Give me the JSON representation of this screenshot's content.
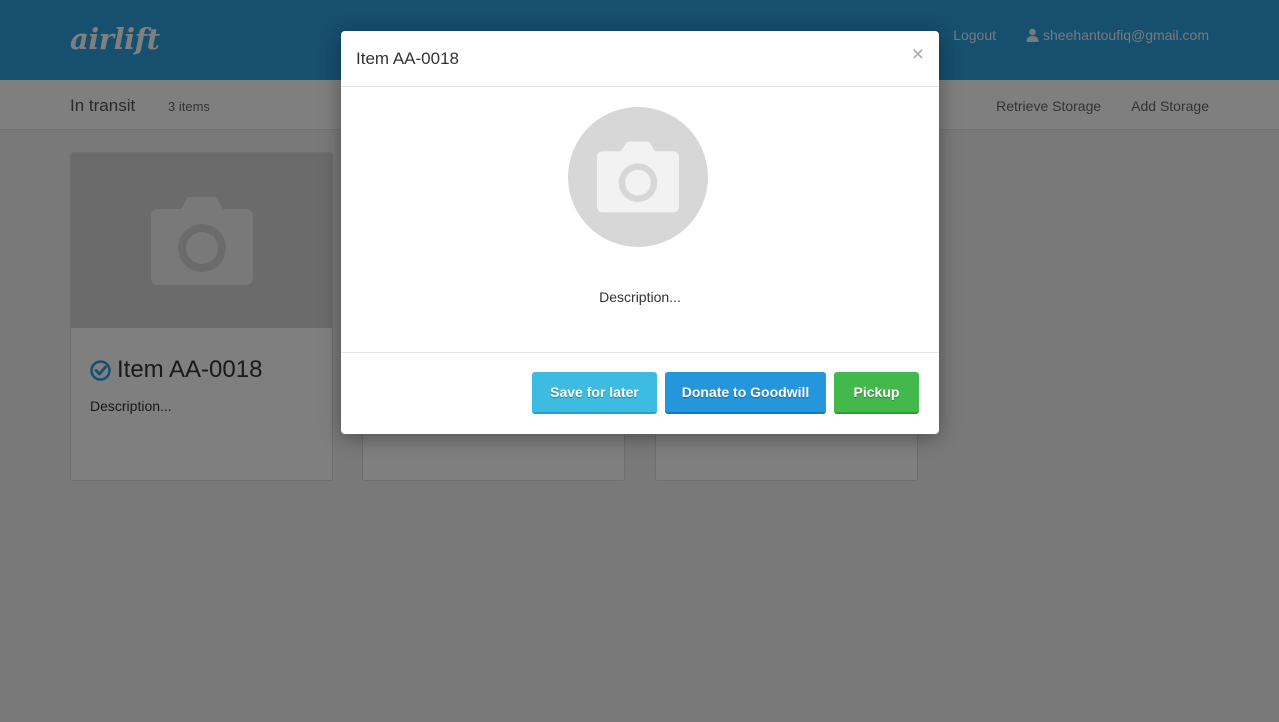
{
  "nav": {
    "brand": "airlift",
    "logout_label": "Logout",
    "user_email": "sheehantoufiq@gmail.com"
  },
  "subbar": {
    "title": "In transit",
    "count": "3 items",
    "retrieve_label": "Retrieve Storage",
    "add_label": "Add Storage"
  },
  "cards": [
    {
      "title": "Item AA-0018",
      "description": "Description..."
    }
  ],
  "modal": {
    "title": "Item AA-0018",
    "close_symbol": "×",
    "description": "Description...",
    "buttons": {
      "save": "Save for later",
      "donate": "Donate to Goodwill",
      "pickup": "Pickup"
    }
  },
  "colors": {
    "navbar": "#2f9fdd",
    "save": "#3cbce0",
    "donate": "#2596db",
    "pickup": "#43b94c",
    "check": "#2f9fdd"
  }
}
